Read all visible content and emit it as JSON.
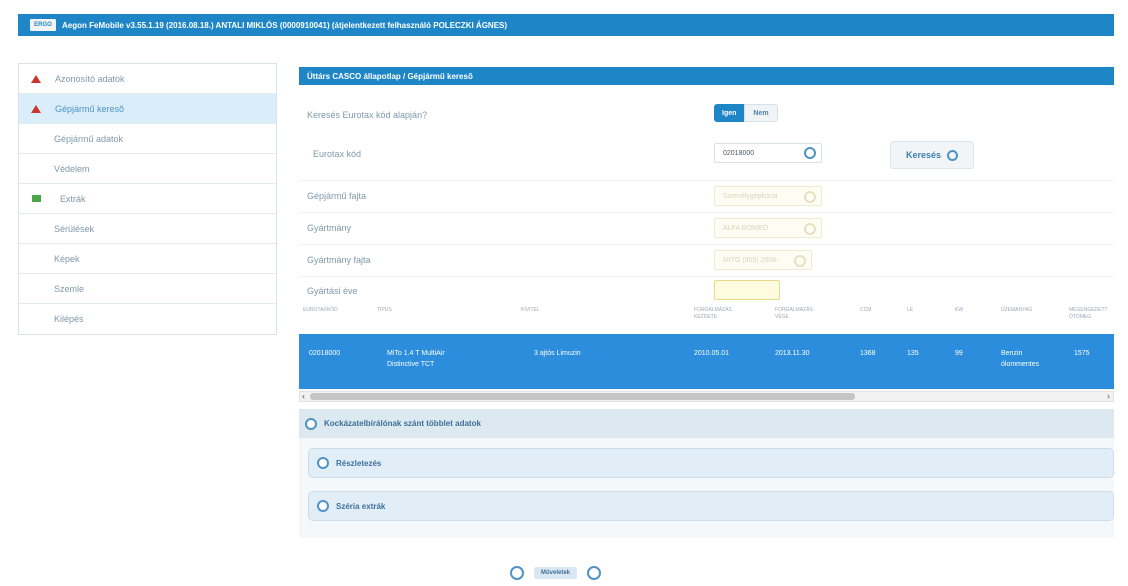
{
  "header": {
    "logo_text": "ERGO",
    "title": "Aegon FeMobile v3.55.1.19 (2016.08.18.) ANTALI MIKLÓS (0000910041) (átjelentkezett felhasználó POLECZKI ÁGNES)"
  },
  "sidebar": {
    "items": [
      {
        "label": "Azonosító adatok",
        "icon": "warning-triangle-icon",
        "status_color": "#c9372c"
      },
      {
        "label": "Gépjármű keresõ",
        "icon": "warning-triangle-icon",
        "status_color": "#c9372c",
        "active": true
      },
      {
        "label": "Gépjármű adatok"
      },
      {
        "label": "Védelem"
      },
      {
        "label": "Extrák",
        "icon": "ok-square-icon",
        "status_color": "#4aa64a"
      },
      {
        "label": "Sérülések"
      },
      {
        "label": "Képek"
      },
      {
        "label": "Szemle"
      },
      {
        "label": "Kilépés"
      }
    ]
  },
  "panel": {
    "title": "Üttárs CASCO állapotlap / Gépjármű keresõ"
  },
  "form": {
    "eurotax_question": "Keresés Eurotax kód alapján?",
    "toggle_yes": "Igen",
    "toggle_no": "Nem",
    "eurotax_label": "Eurotax kód",
    "eurotax_value": "02018000",
    "search_button": "Keresés",
    "vehicle_type_label": "Gépjármű fajta",
    "vehicle_type_value": "Személygépkocsi",
    "make_label": "Gyártmány",
    "make_value": "ALFA ROMEO",
    "model_label": "Gyártmány fajta",
    "model_value": "MITO (955) 2008-",
    "year_label": "Gyártási éve",
    "year_value": ""
  },
  "table": {
    "headers": [
      "EUROTAXKÓD",
      "TÍPUS",
      "KIVITEL",
      "FORGALMAZÁS KEZDETE",
      "FORGALMAZÁS VÉGE",
      "CCM",
      "LE",
      "KW",
      "ÜZEMANYAG",
      "MEGENGEDETT ÖTOMEG"
    ],
    "rows": [
      {
        "eurotax": "02018000",
        "type_line1": "MiTo 1.4 T MultiAir",
        "type_line2": "Distinctive TCT",
        "body": "3 ajtós Limuzin",
        "start": "2010.05.01",
        "end": "2013.11.30",
        "ccm": "1368",
        "le": "135",
        "kw": "99",
        "fuel_line1": "Benzin",
        "fuel_line2": "ólommentes",
        "weight": "1575"
      }
    ]
  },
  "accordions": {
    "main": "Kockázatelbírálónak szánt többlet adatok",
    "details": "Részletezés",
    "series_extras": "Széria extrák"
  },
  "bottom_nav": {
    "label": "Műveletek"
  },
  "colors": {
    "brand_blue": "#1e86c6",
    "selected_row": "#2b8ddb",
    "warning_red": "#c9372c",
    "ok_green": "#4aa64a"
  }
}
